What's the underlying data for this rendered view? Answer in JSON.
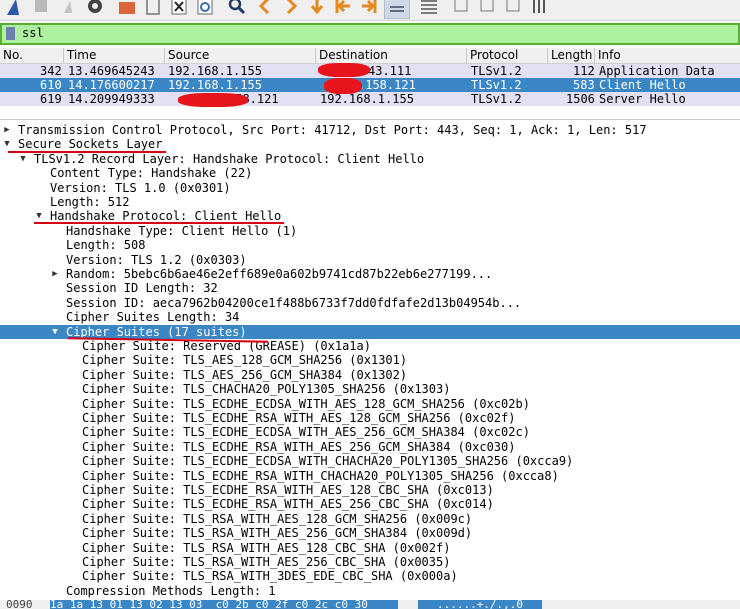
{
  "filter": {
    "value": "ssl"
  },
  "packet_list": {
    "columns": [
      "No.",
      "Time",
      "Source",
      "Destination",
      "Protocol",
      "Length",
      "Info"
    ],
    "rows": [
      {
        "no": "342",
        "time": "13.469645243",
        "source": "192.168.1.155",
        "destination": "43.111",
        "protocol": "TLSv1.2",
        "length": "112",
        "info": "Application Data",
        "selected": false
      },
      {
        "no": "610",
        "time": "14.176600217",
        "source": "192.168.1.155",
        "destination": ".158.121",
        "protocol": "TLSv1.2",
        "length": "583",
        "info": "Client Hello",
        "selected": true
      },
      {
        "no": "619",
        "time": "14.209949333",
        "source": ".58.121",
        "destination": "192.168.1.155",
        "protocol": "TLSv1.2",
        "length": "1506",
        "info": "Server Hello",
        "selected": false
      }
    ]
  },
  "details": [
    {
      "level": 0,
      "arrow": "right",
      "text": "Transmission Control Protocol, Src Port: 41712, Dst Port: 443, Seq: 1, Ack: 1, Len: 517"
    },
    {
      "level": 0,
      "arrow": "down",
      "text": "Secure Sockets Layer"
    },
    {
      "level": 1,
      "arrow": "down",
      "text": "TLSv1.2 Record Layer: Handshake Protocol: Client Hello"
    },
    {
      "level": 2,
      "arrow": "",
      "text": "Content Type: Handshake (22)"
    },
    {
      "level": 2,
      "arrow": "",
      "text": "Version: TLS 1.0 (0x0301)"
    },
    {
      "level": 2,
      "arrow": "",
      "text": "Length: 512"
    },
    {
      "level": 2,
      "arrow": "down",
      "text": "Handshake Protocol: Client Hello"
    },
    {
      "level": 3,
      "arrow": "",
      "text": "Handshake Type: Client Hello (1)"
    },
    {
      "level": 3,
      "arrow": "",
      "text": "Length: 508"
    },
    {
      "level": 3,
      "arrow": "",
      "text": "Version: TLS 1.2 (0x0303)"
    },
    {
      "level": 3,
      "arrow": "right",
      "text": "Random: 5bebc6b6ae46e2eff689e0a602b9741cd87b22eb6e277199..."
    },
    {
      "level": 3,
      "arrow": "",
      "text": "Session ID Length: 32"
    },
    {
      "level": 3,
      "arrow": "",
      "text": "Session ID: aeca7962b04200ce1f488b6733f7dd0fdfafe2d13b04954b..."
    },
    {
      "level": 3,
      "arrow": "",
      "text": "Cipher Suites Length: 34"
    },
    {
      "level": 3,
      "arrow": "down",
      "text": "Cipher Suites (17 suites)",
      "selected": true
    },
    {
      "level": 4,
      "arrow": "",
      "text": "Cipher Suite: Reserved (GREASE) (0x1a1a)"
    },
    {
      "level": 4,
      "arrow": "",
      "text": "Cipher Suite: TLS_AES_128_GCM_SHA256 (0x1301)"
    },
    {
      "level": 4,
      "arrow": "",
      "text": "Cipher Suite: TLS_AES_256_GCM_SHA384 (0x1302)"
    },
    {
      "level": 4,
      "arrow": "",
      "text": "Cipher Suite: TLS_CHACHA20_POLY1305_SHA256 (0x1303)"
    },
    {
      "level": 4,
      "arrow": "",
      "text": "Cipher Suite: TLS_ECDHE_ECDSA_WITH_AES_128_GCM_SHA256 (0xc02b)"
    },
    {
      "level": 4,
      "arrow": "",
      "text": "Cipher Suite: TLS_ECDHE_RSA_WITH_AES_128_GCM_SHA256 (0xc02f)"
    },
    {
      "level": 4,
      "arrow": "",
      "text": "Cipher Suite: TLS_ECDHE_ECDSA_WITH_AES_256_GCM_SHA384 (0xc02c)"
    },
    {
      "level": 4,
      "arrow": "",
      "text": "Cipher Suite: TLS_ECDHE_RSA_WITH_AES_256_GCM_SHA384 (0xc030)"
    },
    {
      "level": 4,
      "arrow": "",
      "text": "Cipher Suite: TLS_ECDHE_ECDSA_WITH_CHACHA20_POLY1305_SHA256 (0xcca9)"
    },
    {
      "level": 4,
      "arrow": "",
      "text": "Cipher Suite: TLS_ECDHE_RSA_WITH_CHACHA20_POLY1305_SHA256 (0xcca8)"
    },
    {
      "level": 4,
      "arrow": "",
      "text": "Cipher Suite: TLS_ECDHE_RSA_WITH_AES_128_CBC_SHA (0xc013)"
    },
    {
      "level": 4,
      "arrow": "",
      "text": "Cipher Suite: TLS_ECDHE_RSA_WITH_AES_256_CBC_SHA (0xc014)"
    },
    {
      "level": 4,
      "arrow": "",
      "text": "Cipher Suite: TLS_RSA_WITH_AES_128_GCM_SHA256 (0x009c)"
    },
    {
      "level": 4,
      "arrow": "",
      "text": "Cipher Suite: TLS_RSA_WITH_AES_256_GCM_SHA384 (0x009d)"
    },
    {
      "level": 4,
      "arrow": "",
      "text": "Cipher Suite: TLS_RSA_WITH_AES_128_CBC_SHA (0x002f)"
    },
    {
      "level": 4,
      "arrow": "",
      "text": "Cipher Suite: TLS_RSA_WITH_AES_256_CBC_SHA (0x0035)"
    },
    {
      "level": 4,
      "arrow": "",
      "text": "Cipher Suite: TLS_RSA_WITH_3DES_EDE_CBC_SHA (0x000a)"
    },
    {
      "level": 3,
      "arrow": "",
      "text": "Compression Methods Length: 1"
    }
  ],
  "bytes_pane": {
    "offset": "0090",
    "hex": "1a 1a 13 01 13 02 13 03  c0 2b c0 2f c0 2c c0 30",
    "ascii": "......+./.,.0"
  },
  "colors": {
    "selection": "#3b86c5",
    "filter_valid": "#adf0a0",
    "annotation_red": "#e8141c",
    "row_highlight": "#e4e0f4"
  },
  "toolbar_icons": [
    "shark-fin-icon",
    "stop-icon",
    "restart-icon",
    "options-gear-icon",
    "open-folder-icon",
    "save-file-icon",
    "close-file-icon",
    "reload-icon",
    "find-icon",
    "go-back-icon",
    "go-forward-icon",
    "go-to-packet-icon",
    "go-first-icon",
    "go-last-icon",
    "autoscroll-icon",
    "colorize-icon",
    "zoom-in-icon",
    "zoom-out-icon",
    "normal-size-icon",
    "resize-columns-icon"
  ]
}
